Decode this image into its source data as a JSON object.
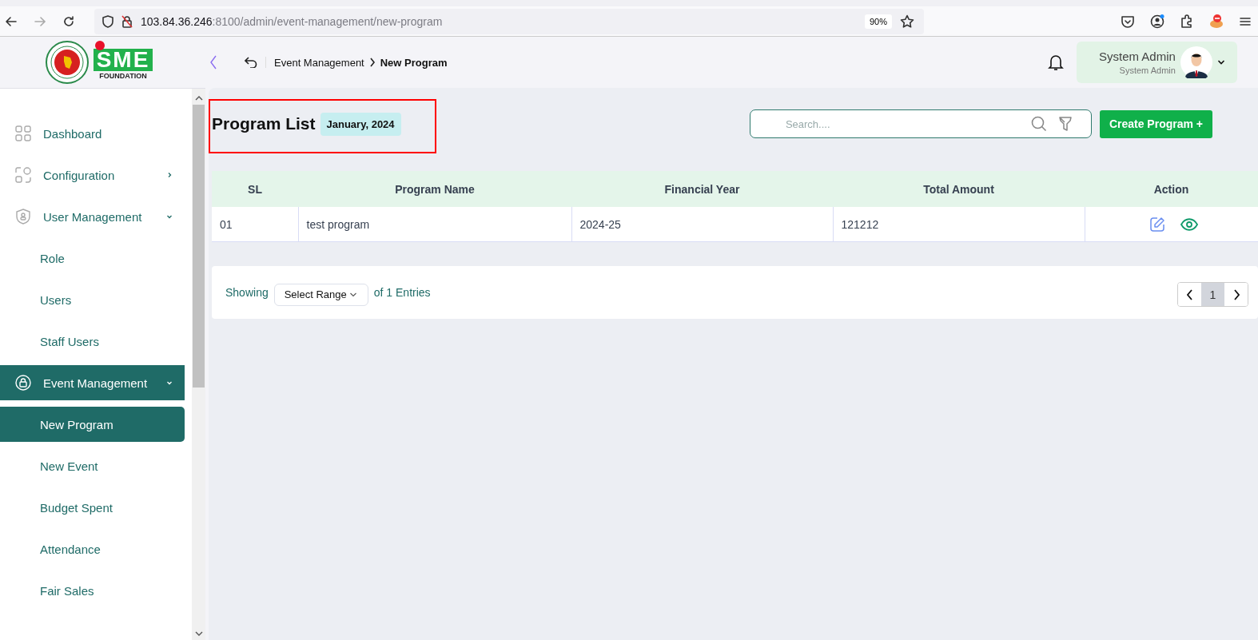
{
  "browser": {
    "url_host": "103.84.36.246",
    "url_rest": ":8100/admin/event-management/new-program",
    "zoom": "90%"
  },
  "header": {
    "breadcrumb": [
      {
        "label": "Event Management",
        "current": false
      },
      {
        "label": "New Program",
        "current": true
      }
    ],
    "user": {
      "name": "System Admin",
      "role": "System Admin"
    }
  },
  "logo": {
    "text": "SME",
    "subtext": "FOUNDATION"
  },
  "sidebar": {
    "items": [
      {
        "label": "Dashboard",
        "selected": false
      },
      {
        "label": "Configuration",
        "selected": false,
        "expanded": false
      },
      {
        "label": "User Management",
        "selected": false,
        "expanded": true,
        "children": [
          {
            "label": "Role",
            "selected": false
          },
          {
            "label": "Users",
            "selected": false
          },
          {
            "label": "Staff Users",
            "selected": false
          }
        ]
      },
      {
        "label": "Event Management",
        "selected": true,
        "expanded": true,
        "children": [
          {
            "label": "New Program",
            "selected": true
          },
          {
            "label": "New Event",
            "selected": false
          },
          {
            "label": "Budget Spent",
            "selected": false
          },
          {
            "label": "Attendance",
            "selected": false
          },
          {
            "label": "Fair Sales",
            "selected": false
          }
        ]
      }
    ]
  },
  "page": {
    "title": "Program List",
    "period": "January, 2024",
    "search": {
      "placeholder": "Search...."
    },
    "create_button": "Create Program +",
    "table": {
      "columns": [
        "SL",
        "Program Name",
        "Financial Year",
        "Total Amount",
        "Action"
      ],
      "rows": [
        {
          "cells": [
            "01",
            "test program",
            "2024-25",
            "121212"
          ]
        }
      ]
    },
    "footer": {
      "showing": "Showing",
      "range_select": "Select Range",
      "entries": "of 1 Entries",
      "pages": [
        {
          "label": "1",
          "selected": true
        }
      ]
    }
  }
}
